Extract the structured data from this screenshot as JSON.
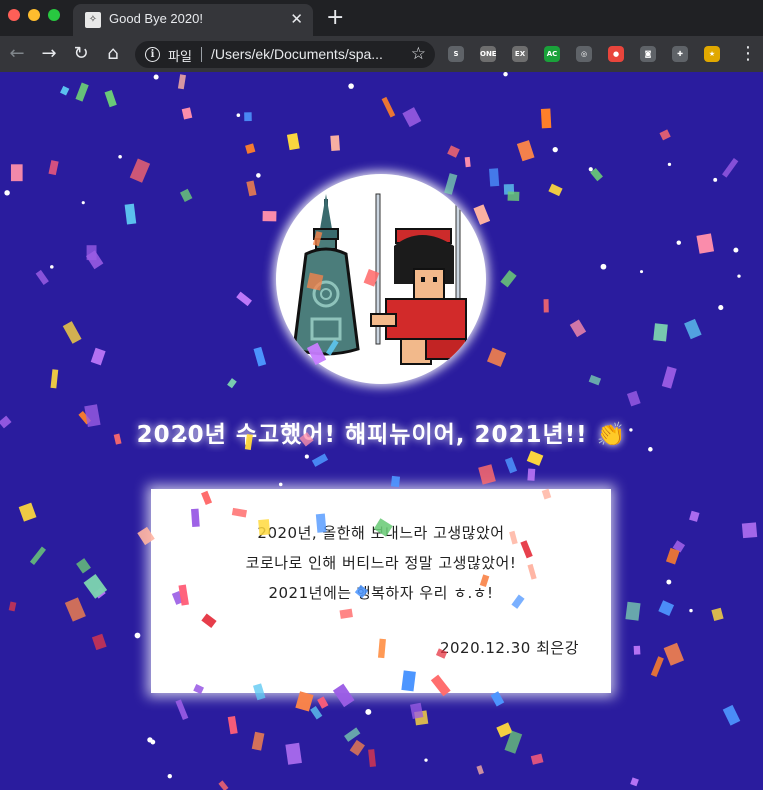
{
  "browser": {
    "tab_title": "Good Bye 2020!",
    "tab_close": "✕",
    "new_tab": "+",
    "omnibox": {
      "scheme_label": "파일",
      "url": "/Users/ek/Documents/spa..."
    },
    "extensions": [
      {
        "name": "skype-extension-icon",
        "glyph": "S",
        "color": "#5f6368"
      },
      {
        "name": "one-extension-icon",
        "glyph": "ONE",
        "color": "#6e6e6e"
      },
      {
        "name": "ex-extension-icon",
        "glyph": "EX",
        "color": "#6e6e6e"
      },
      {
        "name": "ac-extension-icon",
        "glyph": "AC",
        "color": "#1aa13a"
      },
      {
        "name": "circle-extension-icon",
        "glyph": "◎",
        "color": "#5f6368"
      },
      {
        "name": "color-wheel-extension-icon",
        "glyph": "●",
        "color": "#e8453c"
      },
      {
        "name": "camera-extension-icon",
        "glyph": "◙",
        "color": "#5f6368"
      },
      {
        "name": "puzzle-extension-icon",
        "glyph": "✚",
        "color": "#5f6368"
      },
      {
        "name": "profile-avatar-icon",
        "glyph": "★",
        "color": "#e0a800"
      }
    ]
  },
  "page": {
    "background": "#2a1c9e",
    "headline": "2020년 수고했어! 해피뉴이어, 2021년!! 👏",
    "card": {
      "line1": "2020년, 올한해 보내느라 고생많았어",
      "line2": "코로나로 인해 버티느라 정말 고생많았어!",
      "line3": "2021년에는 행복하자 우리 ㅎ.ㅎ!",
      "signature": "2020.12.30 최은강"
    }
  }
}
